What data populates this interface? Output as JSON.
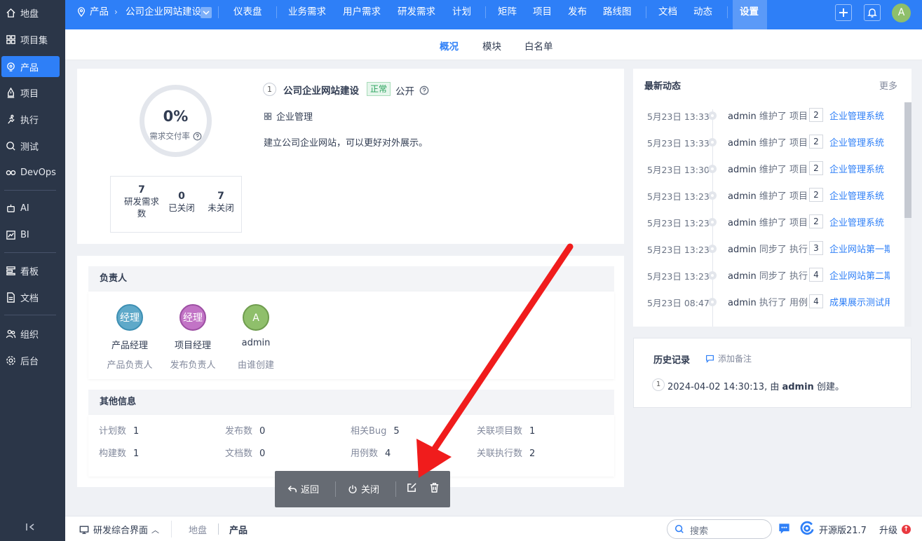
{
  "sidebar": {
    "items": [
      {
        "label": "地盘",
        "icon": "home-icon"
      },
      {
        "label": "项目集",
        "icon": "grid-icon"
      },
      {
        "label": "产品",
        "icon": "bulb-icon"
      },
      {
        "label": "项目",
        "icon": "rocket-icon"
      },
      {
        "label": "执行",
        "icon": "run-icon"
      },
      {
        "label": "测试",
        "icon": "search-icon"
      },
      {
        "label": "DevOps",
        "icon": "infinity-icon"
      },
      {
        "label": "AI",
        "icon": "robot-icon"
      },
      {
        "label": "BI",
        "icon": "chart-icon"
      },
      {
        "label": "看板",
        "icon": "kanban-icon"
      },
      {
        "label": "文档",
        "icon": "doc-icon"
      },
      {
        "label": "组织",
        "icon": "people-icon"
      },
      {
        "label": "后台",
        "icon": "gear-icon"
      }
    ]
  },
  "topbar": {
    "crumb_root": "产品",
    "crumb_product": "公司企业网站建设",
    "nav": [
      "仪表盘",
      "业务需求",
      "用户需求",
      "研发需求",
      "计划",
      "矩阵",
      "项目",
      "发布",
      "路线图",
      "文档",
      "动态",
      "设置"
    ],
    "avatar": "A"
  },
  "subnav": {
    "tabs": [
      "概况",
      "模块",
      "白名单"
    ]
  },
  "overview": {
    "percent": "0%",
    "rate_label": "需求交付率",
    "stats": [
      {
        "num": "7",
        "label1": "研发需求",
        "label2": "数"
      },
      {
        "num": "0",
        "label1": "已关闭",
        "label2": ""
      },
      {
        "num": "7",
        "label1": "未关闭",
        "label2": ""
      }
    ],
    "product_id": "1",
    "product_name": "公司企业网站建设",
    "status": "正常",
    "acl": "公开",
    "line": "企业管理",
    "desc": "建立公司企业网站，可以更好对外展示。"
  },
  "owners": {
    "title": "负责人",
    "people": [
      {
        "avatar": "经理",
        "name": "产品经理",
        "role": "产品负责人",
        "color": "#5fa9c9"
      },
      {
        "avatar": "经理",
        "name": "项目经理",
        "role": "发布负责人",
        "color": "#c274c6"
      },
      {
        "avatar": "A",
        "name": "admin",
        "role": "由谁创建",
        "color": "#8fbf6b"
      }
    ]
  },
  "other": {
    "title": "其他信息",
    "items": [
      {
        "k": "计划数",
        "v": "1"
      },
      {
        "k": "发布数",
        "v": "0"
      },
      {
        "k": "相关Bug",
        "v": "5"
      },
      {
        "k": "关联项目数",
        "v": "1"
      },
      {
        "k": "构建数",
        "v": "1"
      },
      {
        "k": "文档数",
        "v": "0"
      },
      {
        "k": "用例数",
        "v": "4"
      },
      {
        "k": "关联执行数",
        "v": "2"
      }
    ]
  },
  "dynamics": {
    "title": "最新动态",
    "more": "更多",
    "rows": [
      {
        "time": "5月23日 13:33",
        "actor": "admin",
        "verb": "维护了 项目",
        "num": "2",
        "link": "企业管理系统"
      },
      {
        "time": "5月23日 13:33",
        "actor": "admin",
        "verb": "维护了 项目",
        "num": "2",
        "link": "企业管理系统"
      },
      {
        "time": "5月23日 13:30",
        "actor": "admin",
        "verb": "维护了 项目",
        "num": "2",
        "link": "企业管理系统"
      },
      {
        "time": "5月23日 13:23",
        "actor": "admin",
        "verb": "维护了 项目",
        "num": "2",
        "link": "企业管理系统"
      },
      {
        "time": "5月23日 13:23",
        "actor": "admin",
        "verb": "维护了 项目",
        "num": "2",
        "link": "企业管理系统"
      },
      {
        "time": "5月23日 13:23",
        "actor": "admin",
        "verb": "同步了 执行",
        "num": "3",
        "link": "企业网站第一期"
      },
      {
        "time": "5月23日 13:23",
        "actor": "admin",
        "verb": "同步了 执行",
        "num": "4",
        "link": "企业网站第二期"
      },
      {
        "time": "5月23日 08:47",
        "actor": "admin",
        "verb": "执行了 用例",
        "num": "4",
        "link": "成果展示测试用例"
      }
    ]
  },
  "history": {
    "title": "历史记录",
    "add_note": "添加备注",
    "num": "1",
    "entry_prefix": "2024-04-02 14:30:13, 由 ",
    "entry_actor": "admin",
    "entry_suffix": " 创建。"
  },
  "actions": {
    "back": "返回",
    "close": "关闭"
  },
  "bottombar": {
    "mode": "研发综合界面",
    "crumb1": "地盘",
    "crumb2": "产品",
    "search_placeholder": "搜索",
    "edition": "开源版21.7",
    "upgrade": "升级"
  },
  "colors": {
    "primary": "#2e7ff7",
    "sidebar": "#2b3648",
    "annotation_arrow": "#f01c1c"
  }
}
